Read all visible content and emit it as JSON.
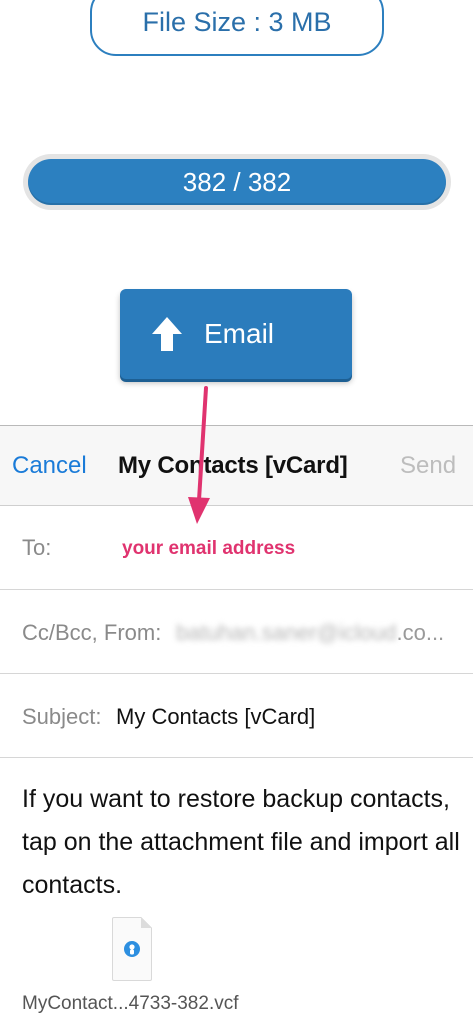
{
  "file_size": {
    "label": "File Size : 3 MB"
  },
  "progress": {
    "text": "382 / 382",
    "current": 382,
    "total": 382,
    "fraction": 1.0
  },
  "email_button": {
    "label": "Email",
    "icon": "up-arrow-icon"
  },
  "compose": {
    "cancel_label": "Cancel",
    "title": "My Contacts [vCard]",
    "send_label": "Send",
    "to_label": "To:",
    "to_hint": "your email address",
    "cc_label": "Cc/Bcc, From:",
    "from_value_blurred": "batuhan.saner@icloud",
    "from_value_suffix": ".co...",
    "subject_label": "Subject:",
    "subject_value": "My Contacts [vCard]",
    "body": "If you want to restore backup contacts, tap on the attachment file and import all contacts.",
    "attachment_name": "MyContact...4733-382.vcf",
    "attachment_icon": "vcard-contact-icon"
  },
  "colors": {
    "accent_blue": "#2b7cbc",
    "ios_link_blue": "#1a7bd8",
    "annotation_pink": "#e0336f",
    "disabled_gray": "#bdbdbd"
  }
}
